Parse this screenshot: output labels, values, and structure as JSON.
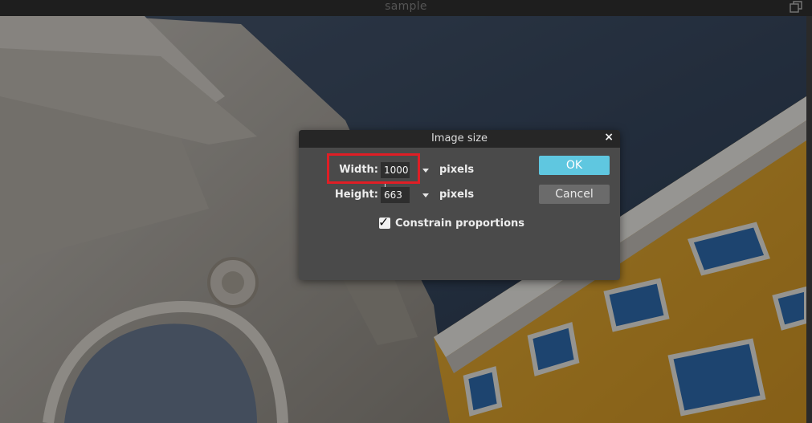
{
  "window": {
    "title": "sample",
    "restore_icon": "restore-window-icon"
  },
  "canvas": {
    "image_description": "building-photo"
  },
  "dialog": {
    "title": "Image size",
    "close_label": "×",
    "width_label": "Width:",
    "width_value": "1000",
    "width_unit": "pixels",
    "height_label": "Height:",
    "height_value": "663",
    "height_unit": "pixels",
    "constrain_label": "Constrain proportions",
    "constrain_checked": true,
    "check_glyph": "✓",
    "ok_label": "OK",
    "cancel_label": "Cancel"
  },
  "colors": {
    "ok_button": "#5fc7e0",
    "highlight": "#e01e25",
    "building_yellow": "#e6a72e",
    "sky": "#2e3e52"
  }
}
